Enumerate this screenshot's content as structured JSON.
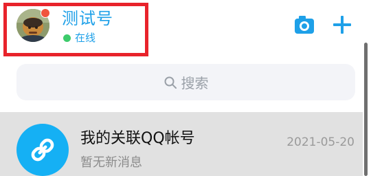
{
  "header": {
    "nickname": "测试号",
    "status_text": "在线",
    "camera_icon": "camera-icon",
    "plus_icon": "plus-icon",
    "accent_color": "#1ea0e8",
    "status_dot_color": "#3dcb6b",
    "avatar_badge_color": "#f0533b",
    "highlight_color": "#e8232b"
  },
  "search": {
    "placeholder": "搜索",
    "icon": "search-icon"
  },
  "conversations": [
    {
      "title": "我的关联QQ帐号",
      "subtitle": "暂无新消息",
      "date": "2021-05-20",
      "icon": "link-icon",
      "icon_color": "#15b0f4"
    }
  ]
}
